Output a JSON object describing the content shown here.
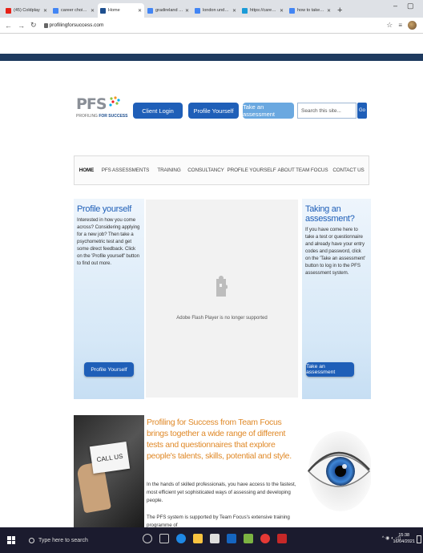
{
  "browser": {
    "tabs": [
      {
        "title": "(45) Coldplay",
        "color": "#e62117",
        "active": false
      },
      {
        "title": "career choices do",
        "color": "#4285f4",
        "active": false
      },
      {
        "title": "Home",
        "color": "#1e4f8f",
        "active": true
      },
      {
        "title": "gradireland - Goo",
        "color": "#4285f4",
        "active": false
      },
      {
        "title": "london undergro",
        "color": "#4285f4",
        "active": false
      },
      {
        "title": "https://careerspo",
        "color": "#1a9bd7",
        "active": false
      },
      {
        "title": "how to take a scre",
        "color": "#4285f4",
        "active": false
      }
    ],
    "new_tab": "+",
    "url": "profilingforsuccess.com"
  },
  "site": {
    "logo_mark": "PFS",
    "logo_tag_prefix": "PROFILING ",
    "logo_tag_bold": "FOR SUCCESS",
    "header_buttons": {
      "client_login": "Client Login",
      "profile_yourself": "Profile Yourself",
      "take_assessment": "Take an assessment"
    },
    "search_placeholder": "Search this site...",
    "search_go": "Go",
    "nav": [
      {
        "label": "HOME",
        "active": true
      },
      {
        "label": "PFS ASSESSMENTS",
        "active": false
      },
      {
        "label": "TRAINING",
        "active": false
      },
      {
        "label": "CONSULTANCY",
        "active": false
      },
      {
        "label": "PROFILE YOURSELF",
        "active": false
      },
      {
        "label": "ABOUT TEAM FOCUS",
        "active": false
      },
      {
        "label": "CONTACT US",
        "active": false
      }
    ],
    "left_panel": {
      "title": "Profile yourself",
      "text": "Interested in how you come across? Considering applying for a new job? Then take a psychometric test and get some direct feedback. Click on the 'Profile yourself' button to find out more.",
      "button": "Profile Yourself"
    },
    "flash_message": "Adobe Flash Player is no longer supported",
    "right_panel": {
      "title": "Taking an assessment?",
      "text": "If you have come here to take a test or questionnaire and already have your entry codes and password, click on the 'Take an assessment' button to log in to the PFS assessment system.",
      "button": "Take an assessment"
    },
    "call_us_card": "CALL US",
    "headline": "Profiling for Success from Team Focus brings together a wide range of different tests and questionnaires that explore people's talents, skills, potential and style.",
    "body1": "In the hands of skilled professionals, you have access to the fastest, most efficient yet sophisticated ways of assessing and developing people.",
    "body2": "The PFS system is supported by Team Focus's extensive training programme of"
  },
  "taskbar": {
    "search_placeholder": "Type here to search",
    "time": "15:38",
    "date": "16/04/2021"
  },
  "colors": {
    "brand_blue": "#1f5fb8",
    "light_blue": "#6aa8e0",
    "headline_orange": "#e08a2a",
    "top_strip": "#1e3a5f"
  }
}
